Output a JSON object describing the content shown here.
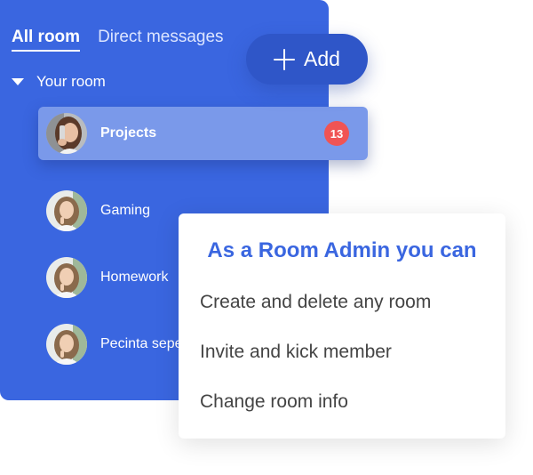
{
  "tabs": {
    "all_room": "All room",
    "direct_messages": "Direct messages"
  },
  "section": {
    "label": "Your room"
  },
  "rooms": [
    {
      "name": "Projects",
      "badge": "13",
      "avatar_icon": "user-avatar-phone"
    },
    {
      "name": "Gaming",
      "avatar_icon": "user-avatar"
    },
    {
      "name": "Homework",
      "avatar_icon": "user-avatar"
    },
    {
      "name": "Pecinta sepe",
      "avatar_icon": "user-avatar"
    }
  ],
  "add_button": {
    "label": "Add",
    "icon": "plus-icon"
  },
  "admin_card": {
    "title": "As a Room Admin you can",
    "items": [
      "Create and delete any room",
      "Invite and kick member",
      "Change room info"
    ]
  },
  "colors": {
    "panel_blue": "#3a66e0",
    "active_row": "#7a99ea",
    "add_button": "#2f56c8",
    "badge_red": "#f05454",
    "title_blue": "#3a66e0",
    "item_text": "#444444"
  }
}
